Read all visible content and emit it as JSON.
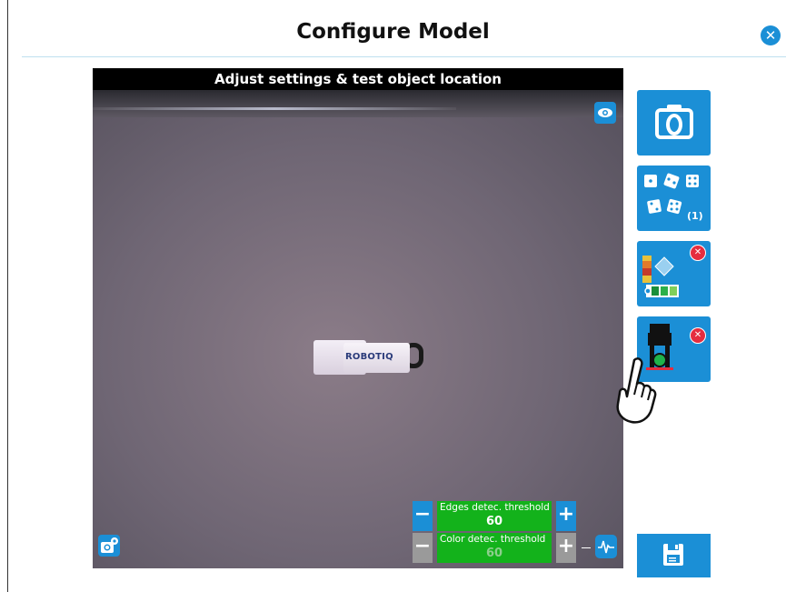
{
  "dialog": {
    "title": "Configure Model",
    "close_icon": "close-icon"
  },
  "viewer": {
    "title": "Adjust settings & test object location",
    "object_logo": "ROBOTIQ",
    "eye_icon": "eye-icon",
    "camera_settings_icon": "camera-settings-icon"
  },
  "thresholds": {
    "edges": {
      "label": "Edges detec. threshold",
      "value": "60",
      "minus": "−",
      "plus": "+"
    },
    "color": {
      "label": "Color detec. threshold",
      "value": "60",
      "minus": "−",
      "plus": "+"
    }
  },
  "sidebar": {
    "snapshot_icon": "camera-icon",
    "poses_icon": "dice-icon",
    "poses_count": "(1)",
    "color_icon": "color-palette-icon",
    "gripper_icon": "gripper-icon",
    "save_icon": "floppy-disk-icon"
  },
  "colors": {
    "accent": "#1b8fd6",
    "threshold_green": "#13b21b",
    "disabled_gray": "#9a9a9a",
    "error_red": "#e52d3f"
  }
}
